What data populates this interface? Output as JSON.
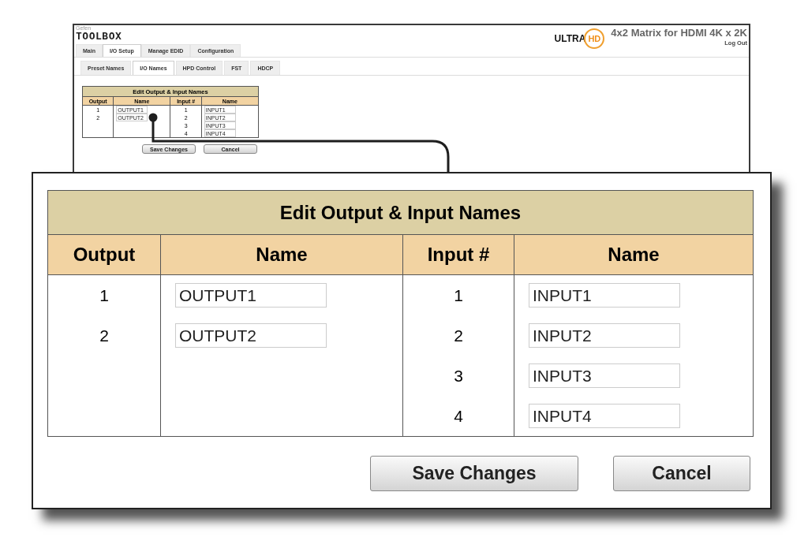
{
  "screen": {
    "brand_top": "Gefen",
    "brand": "TOOLBOX",
    "logo_left": "ULTRA",
    "logo_right": "HD",
    "product_title": "4x2 Matrix for HDMI 4K x 2K",
    "logout": "Log Out",
    "tabs": [
      {
        "label": "Main",
        "selected": false
      },
      {
        "label": "I/O Setup",
        "selected": true
      },
      {
        "label": "Manage EDID",
        "selected": false
      },
      {
        "label": "Configuration",
        "selected": false
      }
    ],
    "subtabs": [
      {
        "label": "Preset Names",
        "selected": false
      },
      {
        "label": "I/O Names",
        "selected": true
      },
      {
        "label": "HPD Control",
        "selected": false
      },
      {
        "label": "FST",
        "selected": false
      },
      {
        "label": "HDCP",
        "selected": false
      }
    ],
    "table": {
      "title": "Edit Output & Input Names",
      "columns": [
        "Output",
        "Name",
        "Input #",
        "Name"
      ],
      "outputs": [
        {
          "number": "1",
          "name": "OUTPUT1"
        },
        {
          "number": "2",
          "name": "OUTPUT2"
        }
      ],
      "inputs": [
        {
          "number": "1",
          "name": "INPUT1"
        },
        {
          "number": "2",
          "name": "INPUT2"
        },
        {
          "number": "3",
          "name": "INPUT3"
        },
        {
          "number": "4",
          "name": "INPUT4"
        }
      ]
    },
    "buttons": [
      "Save Changes",
      "Cancel"
    ]
  },
  "callout": {
    "table": {
      "title": "Edit Output & Input Names",
      "columns": [
        "Output",
        "Name",
        "Input #",
        "Name"
      ],
      "outputs": [
        {
          "number": "1",
          "name": "OUTPUT1"
        },
        {
          "number": "2",
          "name": "OUTPUT2"
        }
      ],
      "inputs": [
        {
          "number": "1",
          "name": "INPUT1"
        },
        {
          "number": "2",
          "name": "INPUT2"
        },
        {
          "number": "3",
          "name": "INPUT3"
        },
        {
          "number": "4",
          "name": "INPUT4"
        }
      ]
    },
    "buttons": [
      "Save Changes",
      "Cancel"
    ]
  }
}
